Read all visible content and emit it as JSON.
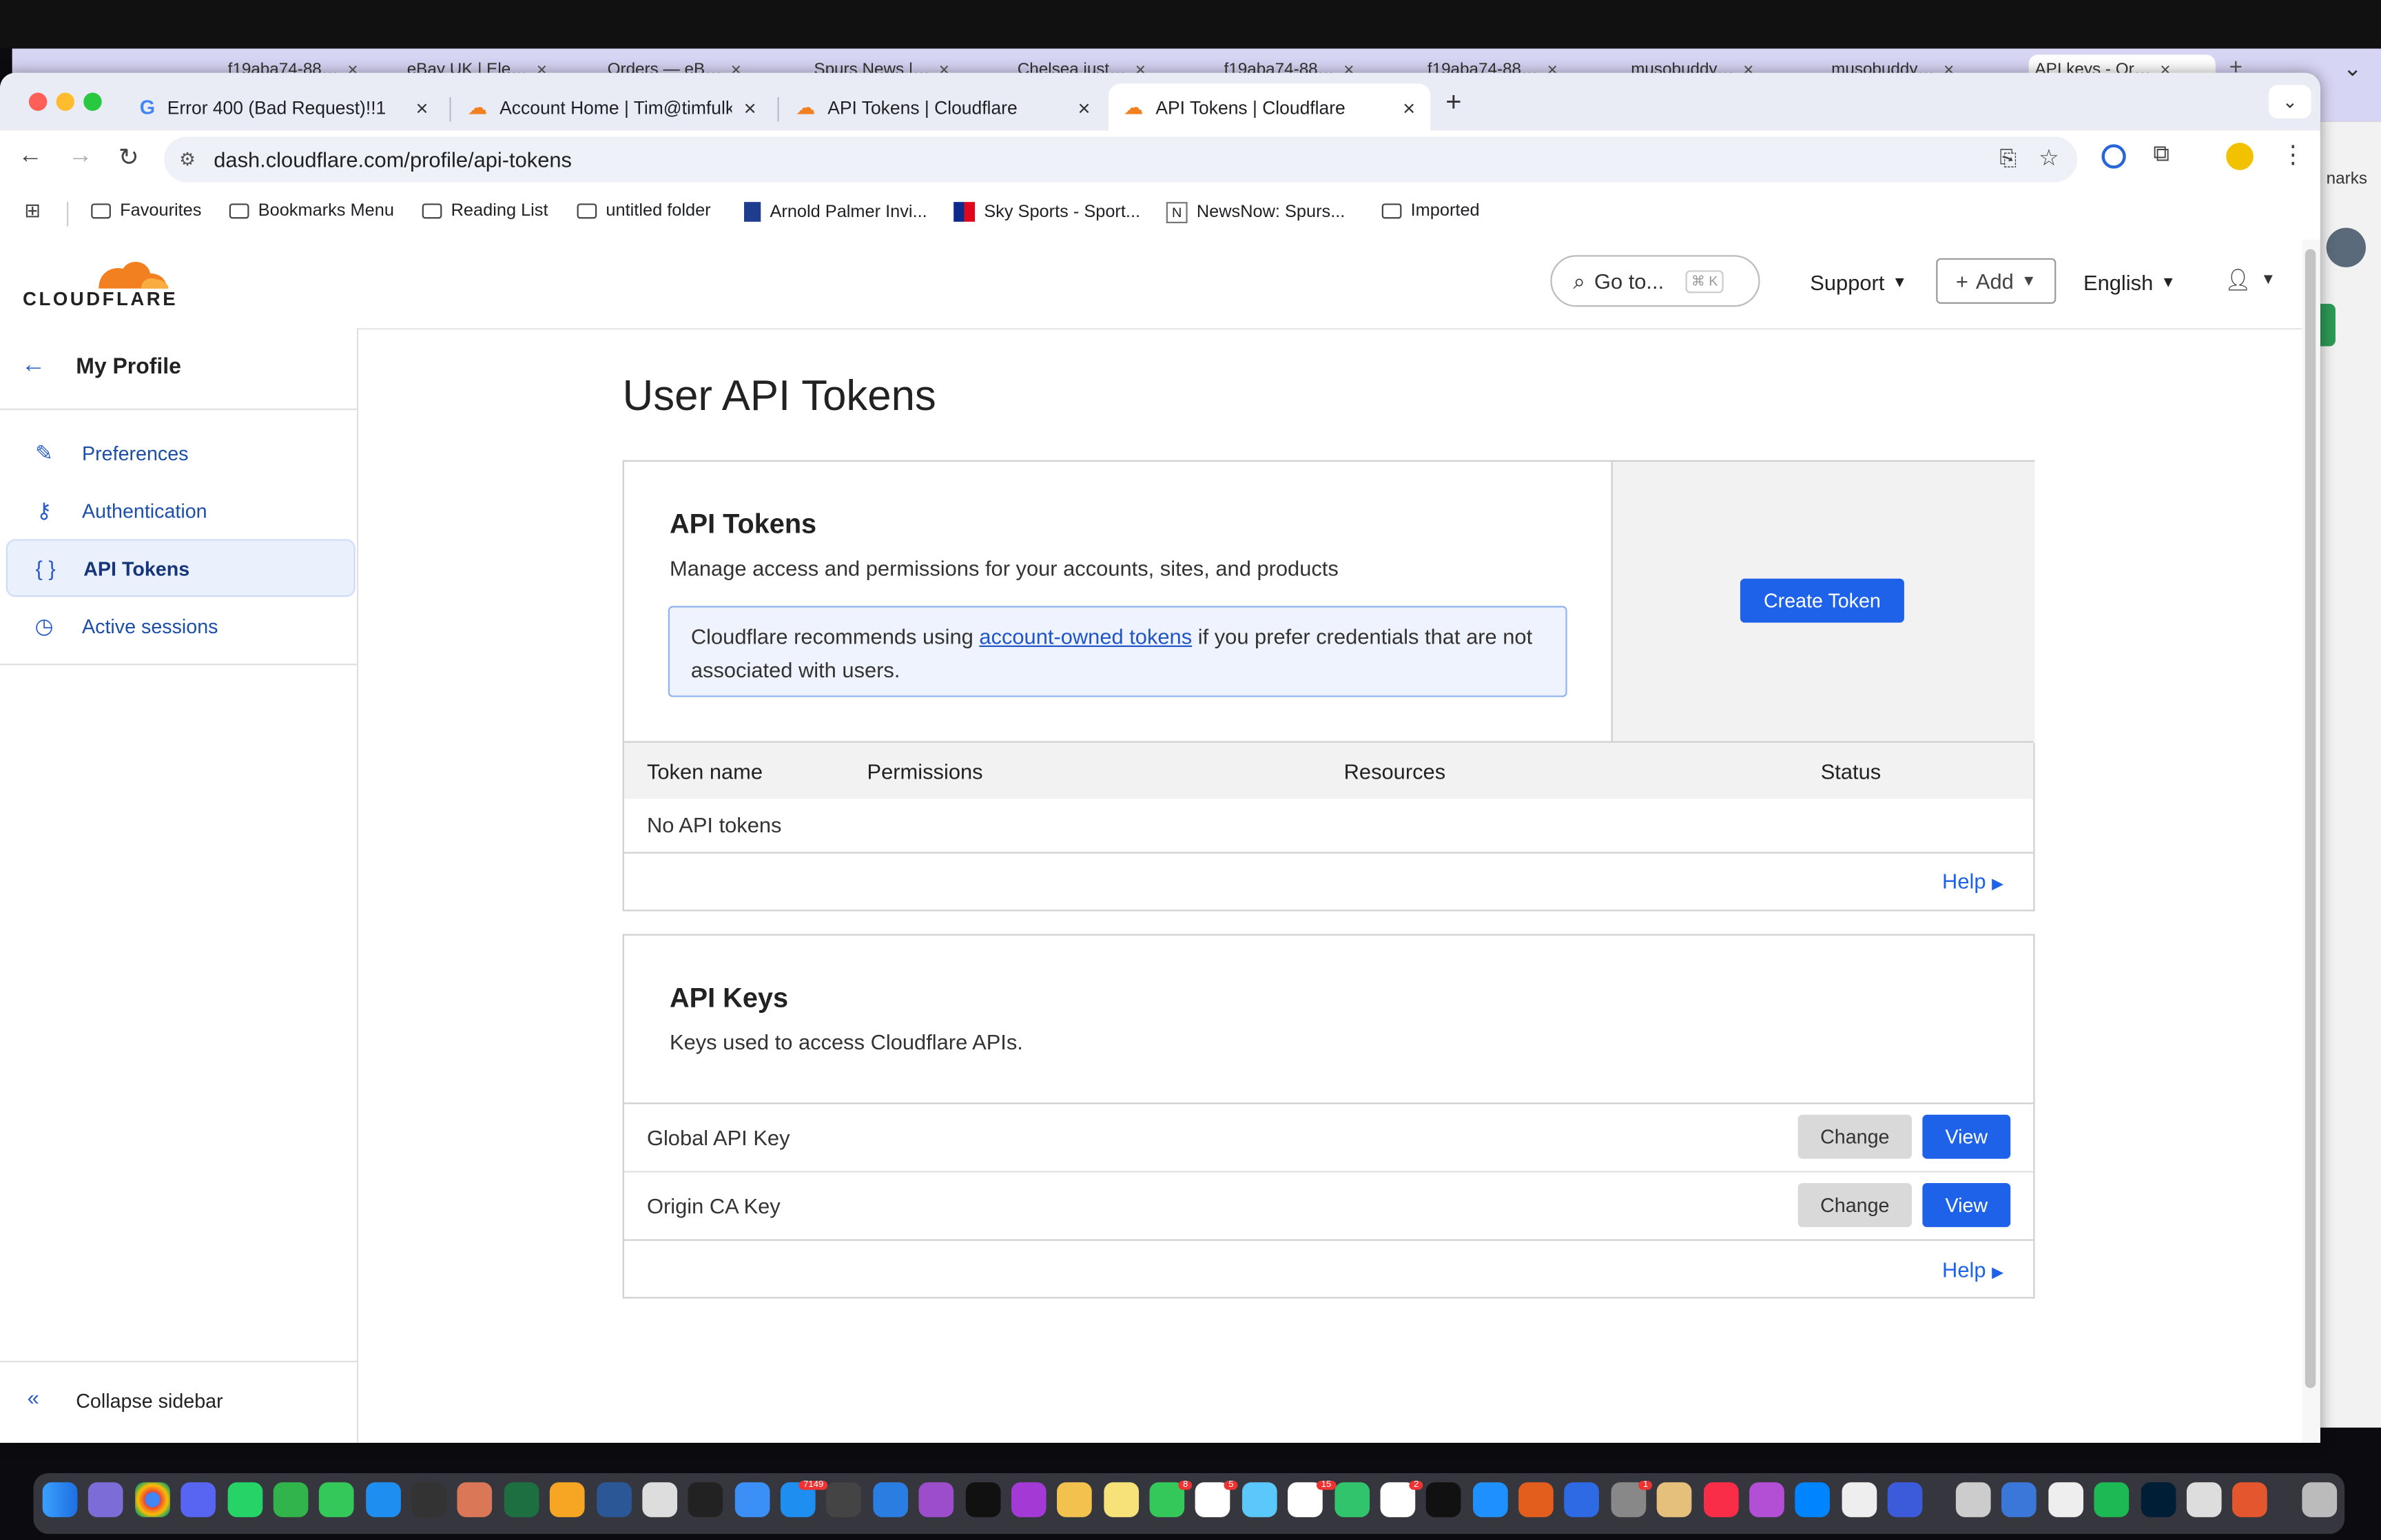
{
  "background_window": {
    "tabs": [
      "f19aba74-88…",
      "eBay UK | Ele…",
      "Orders — eB…",
      "Spurs News |…",
      "Chelsea just…",
      "f19aba74-88…",
      "f19aba74-88…",
      "musobuddy…",
      "musobuddy…",
      "API keys - Or…"
    ],
    "right_text": "narks"
  },
  "browser": {
    "tabs": [
      {
        "title": "Error 400 (Bad Request)!!1"
      },
      {
        "title": "Account Home | Tim@timfulke"
      },
      {
        "title": "API Tokens | Cloudflare"
      },
      {
        "title": "API Tokens | Cloudflare"
      }
    ],
    "url": "dash.cloudflare.com/profile/api-tokens",
    "bookmarks": [
      "Favourites",
      "Bookmarks Menu",
      "Reading List",
      "untitled folder",
      "Arnold Palmer Invi...",
      "Sky Sports - Sport...",
      "NewsNow: Spurs...",
      "Imported"
    ]
  },
  "header": {
    "logo_text": "CLOUDFLARE",
    "search_label": "Go to...",
    "search_shortcut": "⌘ K",
    "support": "Support",
    "add": "Add",
    "language": "English"
  },
  "sidebar": {
    "title": "My Profile",
    "items": [
      {
        "label": "Preferences"
      },
      {
        "label": "Authentication"
      },
      {
        "label": "API Tokens"
      },
      {
        "label": "Active sessions"
      }
    ],
    "collapse": "Collapse sidebar"
  },
  "main": {
    "title": "User API Tokens",
    "tokens": {
      "heading": "API Tokens",
      "description": "Manage access and permissions for your accounts, sites, and products",
      "notice_before": "Cloudflare recommends using",
      "notice_link": "account-owned tokens",
      "notice_after": "if you prefer credentials that are not associated with users.",
      "create_button": "Create Token",
      "columns": [
        "Token name",
        "Permissions",
        "Resources",
        "Status"
      ],
      "empty": "No API tokens",
      "help": "Help"
    },
    "keys": {
      "heading": "API Keys",
      "description": "Keys used to access Cloudflare APIs.",
      "rows": [
        {
          "name": "Global API Key",
          "change": "Change",
          "view": "View"
        },
        {
          "name": "Origin CA Key",
          "change": "Change",
          "view": "View"
        }
      ],
      "help": "Help"
    }
  },
  "dock": {
    "badges": [
      "8",
      "5",
      "7149",
      "15",
      "2",
      "1"
    ]
  },
  "colors": {
    "accent": "#1f62ea",
    "cloudflare_orange": "#f38020",
    "nav_text": "#1d4ea8"
  }
}
